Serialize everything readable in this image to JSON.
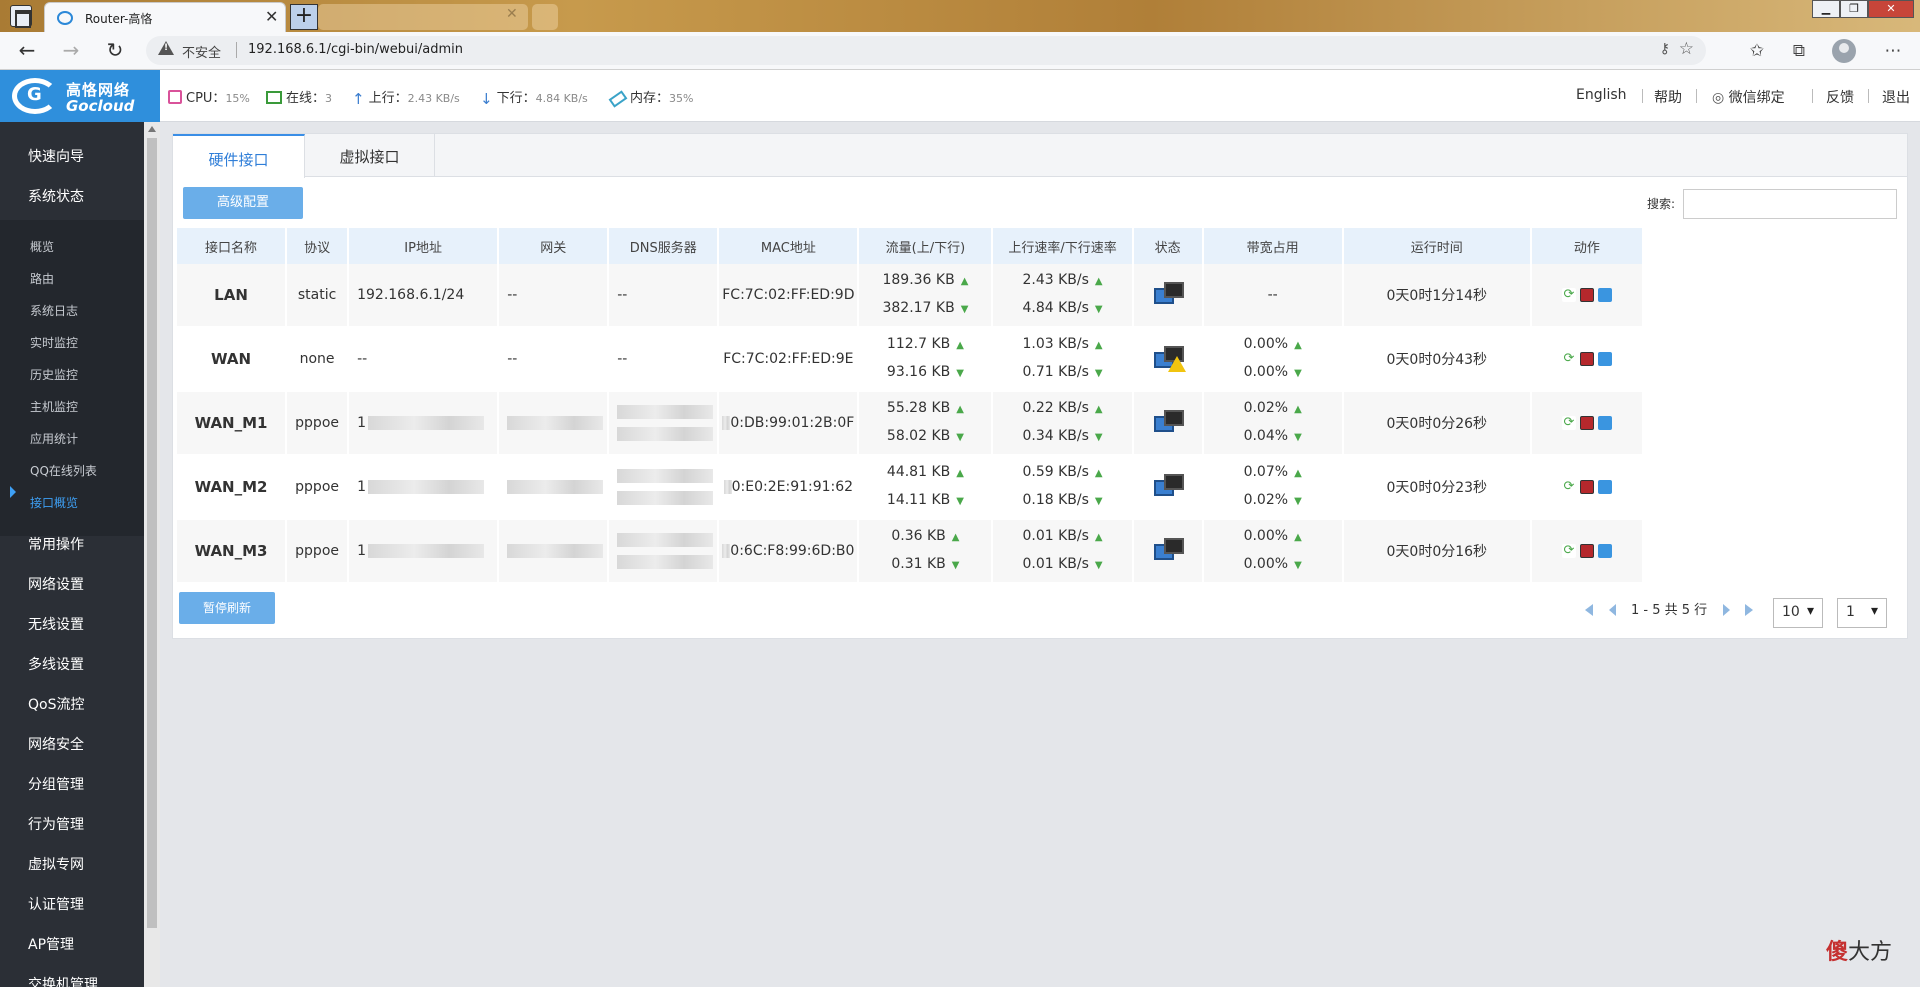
{
  "browser": {
    "tab_title": "Router-高恪",
    "insecure_label": "不安全",
    "url": "192.168.6.1/cgi-bin/webui/admin"
  },
  "brand": {
    "cn": "高恪网络",
    "en": "Gocloud"
  },
  "status": {
    "cpu_label": "CPU：",
    "cpu_value": "15%",
    "online_label": "在线：",
    "online_value": "3",
    "up_label": "上行：",
    "up_value": "2.43 KB/s",
    "down_label": "下行：",
    "down_value": "4.84 KB/s",
    "mem_label": "内存：",
    "mem_value": "35%"
  },
  "toplinks": {
    "english": "English",
    "help": "帮助",
    "wechat": "微信绑定",
    "feedback": "反馈",
    "logout": "退出"
  },
  "sidebar": {
    "top": [
      "快速向导",
      "系统状态"
    ],
    "sub": [
      "概览",
      "路由",
      "系统日志",
      "实时监控",
      "历史监控",
      "主机监控",
      "应用统计",
      "QQ在线列表",
      "接口概览"
    ],
    "active_sub": "接口概览",
    "bottom": [
      "常用操作",
      "网络设置",
      "无线设置",
      "多线设置",
      "QoS流控",
      "网络安全",
      "分组管理",
      "行为管理",
      "虚拟专网",
      "认证管理",
      "AP管理",
      "交换机管理"
    ]
  },
  "tabs": {
    "hardware": "硬件接口",
    "virtual": "虚拟接口"
  },
  "buttons": {
    "advanced": "高级配置",
    "pause": "暂停刷新"
  },
  "search": {
    "label": "搜索:",
    "value": ""
  },
  "table": {
    "headers": [
      "接口名称",
      "协议",
      "IP地址",
      "网关",
      "DNS服务器",
      "MAC地址",
      "流量(上/下行)",
      "上行速率/下行速率",
      "状态",
      "带宽占用",
      "运行时间",
      "动作"
    ],
    "rows": [
      {
        "name": "LAN",
        "proto": "static",
        "ip": "192.168.6.1/24",
        "gw": "--",
        "dns": "--",
        "mac": "FC:7C:02:FF:ED:9D",
        "tx": "189.36 KB",
        "rx": "382.17 KB",
        "up": "2.43 KB/s",
        "down": "4.84 KB/s",
        "bw1": "--",
        "bw2": "",
        "uptime": "0天0时1分14秒",
        "warn": false
      },
      {
        "name": "WAN",
        "proto": "none",
        "ip": "--",
        "gw": "--",
        "dns": "--",
        "mac": "FC:7C:02:FF:ED:9E",
        "tx": "112.7 KB",
        "rx": "93.16 KB",
        "up": "1.03 KB/s",
        "down": "0.71 KB/s",
        "bw1": "0.00%",
        "bw2": "0.00%",
        "uptime": "0天0时0分43秒",
        "warn": true
      },
      {
        "name": "WAN_M1",
        "proto": "pppoe",
        "ip": "1",
        "gw": "",
        "dns": "",
        "mac": "0:DB:99:01:2B:0F",
        "tx": "55.28 KB",
        "rx": "58.02 KB",
        "up": "0.22 KB/s",
        "down": "0.34 KB/s",
        "bw1": "0.02%",
        "bw2": "0.04%",
        "uptime": "0天0时0分26秒",
        "warn": false
      },
      {
        "name": "WAN_M2",
        "proto": "pppoe",
        "ip": "1",
        "gw": "",
        "dns": "",
        "mac": "0:E0:2E:91:91:62",
        "tx": "44.81 KB",
        "rx": "14.11 KB",
        "up": "0.59 KB/s",
        "down": "0.18 KB/s",
        "bw1": "0.07%",
        "bw2": "0.02%",
        "uptime": "0天0时0分23秒",
        "warn": false
      },
      {
        "name": "WAN_M3",
        "proto": "pppoe",
        "ip": "1",
        "gw": "",
        "dns": "",
        "mac": "0:6C:F8:99:6D:B0",
        "tx": "0.36 KB",
        "rx": "0.31 KB",
        "up": "0.01 KB/s",
        "down": "0.01 KB/s",
        "bw1": "0.00%",
        "bw2": "0.00%",
        "uptime": "0天0时0分16秒",
        "warn": false
      }
    ]
  },
  "pager": {
    "summary": "1 - 5 共 5 行",
    "page_size": "10",
    "page": "1"
  },
  "watermark": {
    "a": "傻",
    "b": "大方"
  }
}
